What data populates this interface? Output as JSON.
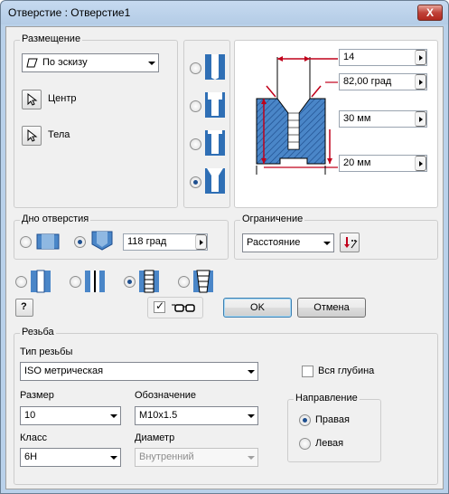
{
  "window": {
    "title": "Отверстие : Отверстие1",
    "close_glyph": "X"
  },
  "placement": {
    "group_label": "Размещение",
    "mode_value": "По эскизу",
    "mode_icon": "sketch-icon",
    "center_label": "Центр",
    "bodies_label": "Тела"
  },
  "hole_types": {
    "selected_index": 3
  },
  "dimensions": {
    "diameter_value": "14",
    "angle_value": "82,00 град",
    "depth_value": "30 мм",
    "total_value": "20 мм"
  },
  "bottom": {
    "group_label": "Дно отверстия",
    "angle_value": "118 град"
  },
  "termination": {
    "group_label": "Ограничение",
    "value": "Расстояние"
  },
  "buttons": {
    "ok": "OK",
    "cancel": "Отмена",
    "help_glyph": "?"
  },
  "thread": {
    "group_label": "Резьба",
    "type_label": "Тип резьбы",
    "type_value": "ISO метрическая",
    "full_depth_label": "Вся глубина",
    "size_label": "Размер",
    "size_value": "10",
    "designation_label": "Обозначение",
    "designation_value": "M10x1.5",
    "class_label": "Класс",
    "class_value": "6H",
    "diameter_label": "Диаметр",
    "diameter_value": "Внутренний",
    "direction": {
      "group_label": "Направление",
      "right_label": "Правая",
      "left_label": "Левая"
    }
  },
  "colors": {
    "section_fill": "#2f6fb5",
    "hatch": "#1f4f8f",
    "dim_line": "#c0001a"
  }
}
